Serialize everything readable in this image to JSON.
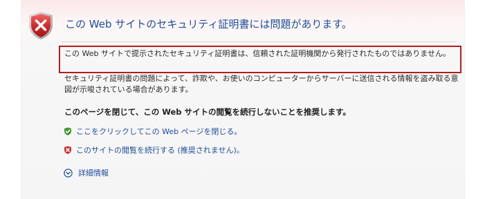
{
  "header": {
    "title": "この Web サイトのセキュリティ証明書には問題があります。"
  },
  "content": {
    "para1": "この Web サイトで提示されたセキュリティ証明書は、信頼された証明機関から発行されたものではありません。",
    "para2": "セキュリティ証明書の問題によって、詐欺や、お使いのコンピューターからサーバーに送信される情報を盗み取る意図が示唆されている場合があります。",
    "recommendation": "このページを閉じて、この Web サイトの閲覧を続行しないことを推奨します。"
  },
  "actions": {
    "close_label": "ここをクリックしてこの Web ページを閉じる。",
    "continue_label": "このサイトの閲覧を続行する (推奨されません)。",
    "details_label": "詳細情報"
  },
  "colors": {
    "link": "#1f4d9c",
    "highlight_border": "#b41c1c",
    "shield_red": "#d42a2a",
    "check_green": "#3f9a2f"
  },
  "icons": {
    "header": "security-shield-error-icon",
    "close": "green-check-shield-icon",
    "continue": "red-x-shield-icon",
    "details": "expand-circle-icon"
  }
}
